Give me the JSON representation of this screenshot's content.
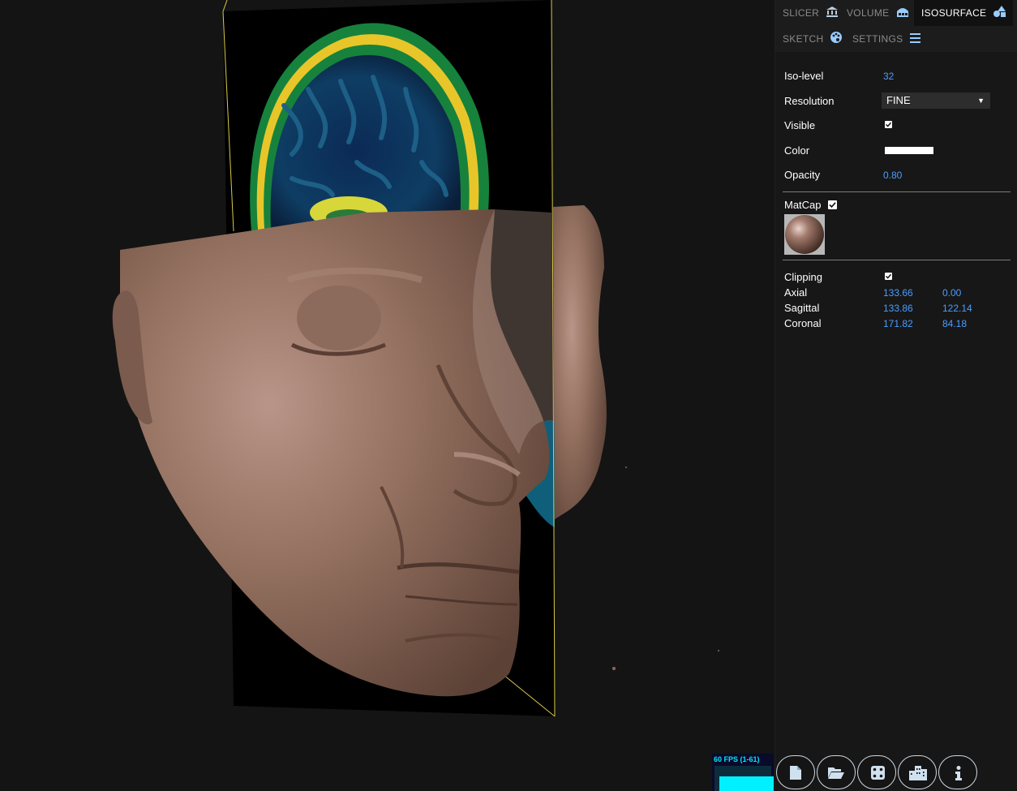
{
  "tabs": [
    {
      "label": "SLICER",
      "icon": "university-icon",
      "active": false
    },
    {
      "label": "VOLUME",
      "icon": "cubes-icon",
      "active": false
    },
    {
      "label": "ISOSURFACE",
      "icon": "shapes-icon",
      "active": true
    },
    {
      "label": "SKETCH",
      "icon": "palette-icon",
      "active": false
    },
    {
      "label": "SETTINGS",
      "icon": "bars-icon",
      "active": false
    }
  ],
  "iso": {
    "iso_level_label": "Iso-level",
    "iso_level_value": "32",
    "resolution_label": "Resolution",
    "resolution_value": "FINE",
    "visible_label": "Visible",
    "visible_checked": true,
    "color_label": "Color",
    "color_value": "#ffffff",
    "opacity_label": "Opacity",
    "opacity_value": "0.80"
  },
  "matcap": {
    "label": "MatCap",
    "checked": true
  },
  "clipping": {
    "label": "Clipping",
    "checked": true,
    "rows": [
      {
        "label": "Axial",
        "min": "133.66",
        "max": "0.00"
      },
      {
        "label": "Sagittal",
        "min": "133.86",
        "max": "122.14"
      },
      {
        "label": "Coronal",
        "min": "171.82",
        "max": "84.18"
      }
    ]
  },
  "fps": {
    "label": "60 FPS (1-61)"
  },
  "toolbar": [
    {
      "name": "new-file-button",
      "icon": "file-icon"
    },
    {
      "name": "open-folder-button",
      "icon": "folder-open-icon"
    },
    {
      "name": "random-dice-button",
      "icon": "dice-icon"
    },
    {
      "name": "sample-datasets-button",
      "icon": "city-icon"
    },
    {
      "name": "info-button",
      "icon": "info-icon"
    }
  ],
  "colors": {
    "accent": "#4a9eff",
    "panel": "#171717",
    "tabbar": "#1c1c1c",
    "skin": "#8a6a5c",
    "fps": "#00f0ff"
  }
}
